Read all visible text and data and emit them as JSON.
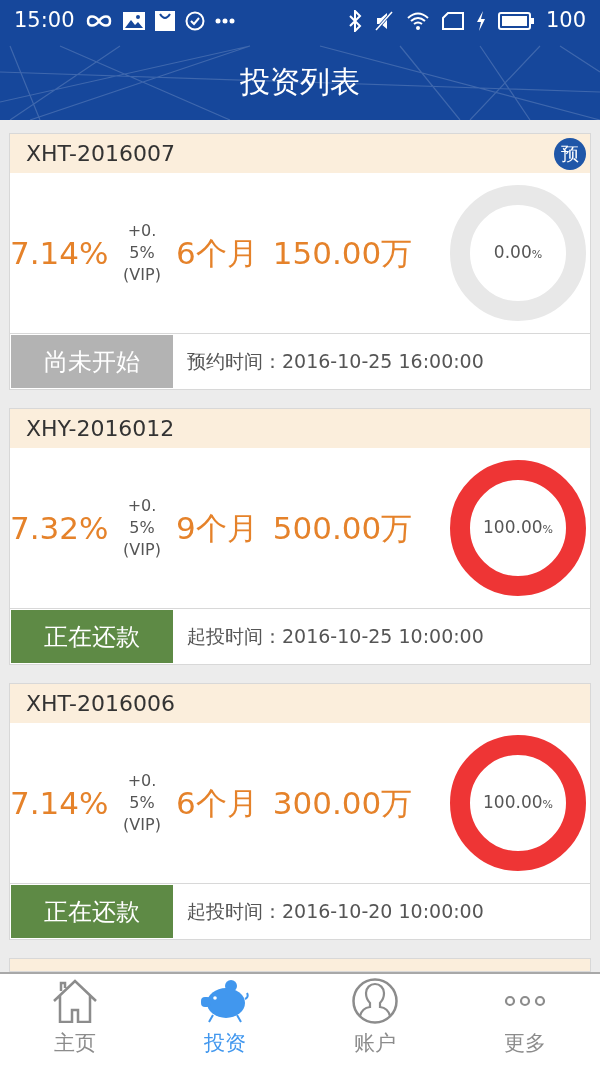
{
  "status_bar": {
    "time": "15:00",
    "battery": "100"
  },
  "title": "投资列表",
  "products": [
    {
      "code": "XHT-2016007",
      "badge": "预",
      "rate": "7.14%",
      "bonus": "+0.\n5%\n(VIP)",
      "term": "6个月",
      "amount": "150.00万",
      "progress": "0.00",
      "progress_unit": "%",
      "status": "尚未开始",
      "kind": "pending",
      "time_label": "预约时间：",
      "time": "2016-10-25 16:00:00"
    },
    {
      "code": "XHY-2016012",
      "rate": "7.32%",
      "bonus": "+0.\n5%\n(VIP)",
      "term": "9个月",
      "amount": "500.00万",
      "progress": "100.00",
      "progress_unit": "%",
      "status": "正在还款",
      "kind": "repaying",
      "time_label": "起投时间：",
      "time": "2016-10-25 10:00:00"
    },
    {
      "code": "XHT-2016006",
      "rate": "7.14%",
      "bonus": "+0.\n5%\n(VIP)",
      "term": "6个月",
      "amount": "300.00万",
      "progress": "100.00",
      "progress_unit": "%",
      "status": "正在还款",
      "kind": "repaying",
      "time_label": "起投时间：",
      "time": "2016-10-20 10:00:00"
    }
  ],
  "tabs": [
    {
      "label": "主页",
      "selected": false
    },
    {
      "label": "投资",
      "selected": true
    },
    {
      "label": "账户",
      "selected": false
    },
    {
      "label": "更多",
      "selected": false
    }
  ]
}
